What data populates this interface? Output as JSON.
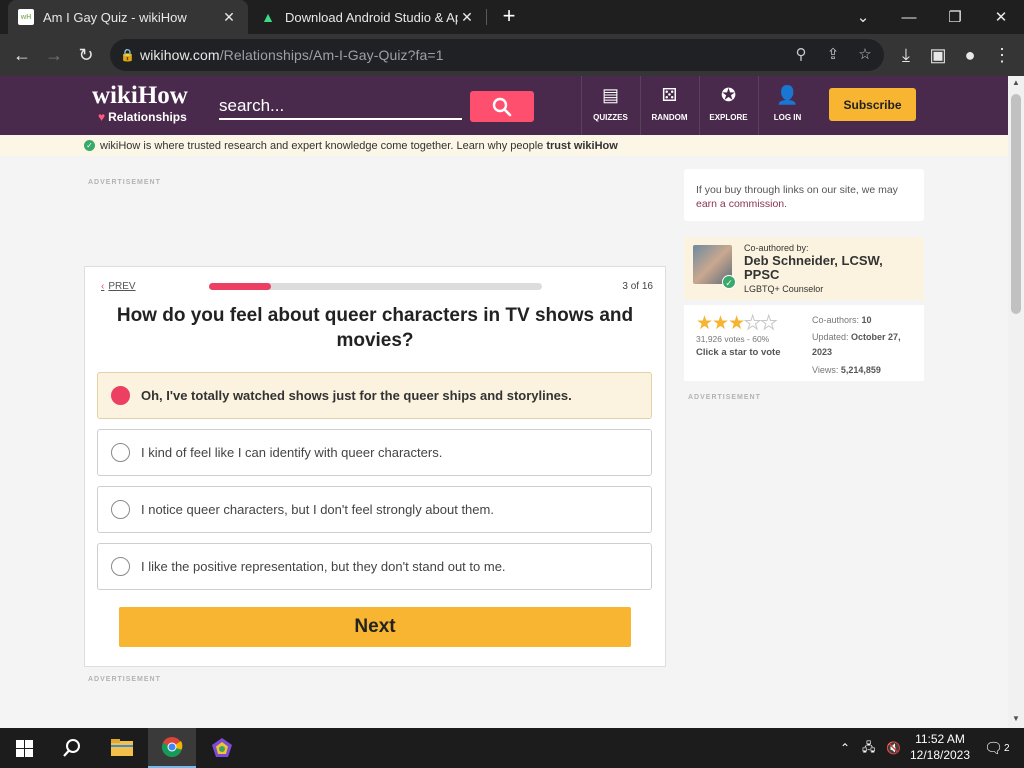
{
  "browser": {
    "tabs": [
      {
        "title": "Am I Gay Quiz - wikiHow",
        "favicon": "wikihow-favicon",
        "active": true
      },
      {
        "title": "Download Android Studio & App",
        "favicon": "android-favicon",
        "active": false
      }
    ],
    "url_host": "wikihow.com",
    "url_path": "/Relationships/Am-I-Gay-Quiz?fa=1"
  },
  "site": {
    "logo_name": "wikiHow",
    "logo_category": "Relationships",
    "search_placeholder": "search...",
    "nav": [
      {
        "label": "QUIZZES",
        "icon": "quiz-icon"
      },
      {
        "label": "RANDOM",
        "icon": "dice-icon"
      },
      {
        "label": "EXPLORE",
        "icon": "compass-icon"
      },
      {
        "label": "LOG IN",
        "icon": "user-icon"
      }
    ],
    "subscribe_label": "Subscribe",
    "trust_text": "wikiHow is where trusted research and expert knowledge come together. Learn why people ",
    "trust_bold": "trust wikiHow",
    "ad_label": "ADVERTISEMENT",
    "colors": {
      "header": "#4a2a4c",
      "accent": "#ed3f61",
      "button": "#f7b531"
    }
  },
  "quiz": {
    "prev_label": "PREV",
    "progress_fraction": 0.1875,
    "page_count": "3 of 16",
    "question": "How do you feel about queer characters in TV shows and movies?",
    "options": [
      {
        "text": "Oh, I've totally watched shows just for the queer ships and storylines.",
        "selected": true
      },
      {
        "text": "I kind of feel like I can identify with queer characters.",
        "selected": false
      },
      {
        "text": "I notice queer characters, but I don't feel strongly about them.",
        "selected": false
      },
      {
        "text": "I like the positive representation, but they don't stand out to me.",
        "selected": false
      }
    ],
    "next_label": "Next"
  },
  "sidebar": {
    "disclosure_text": "If you buy through links on our site, we may ",
    "disclosure_link": "earn a commission",
    "coauthored_label": "Co-authored by:",
    "author_name": "Deb Schneider, LCSW, PPSC",
    "author_role": "LGBTQ+ Counselor",
    "rating_stars": 3,
    "votes_text": "31,926 votes - 60%",
    "click_star_text": "Click a star to vote",
    "coauthors_label": "Co-authors:",
    "coauthors_value": "10",
    "updated_label": "Updated:",
    "updated_value": "October 27, 2023",
    "views_label": "Views:",
    "views_value": "5,214,859"
  },
  "taskbar": {
    "time": "11:52 AM",
    "date": "12/18/2023",
    "notification_count": "2"
  }
}
